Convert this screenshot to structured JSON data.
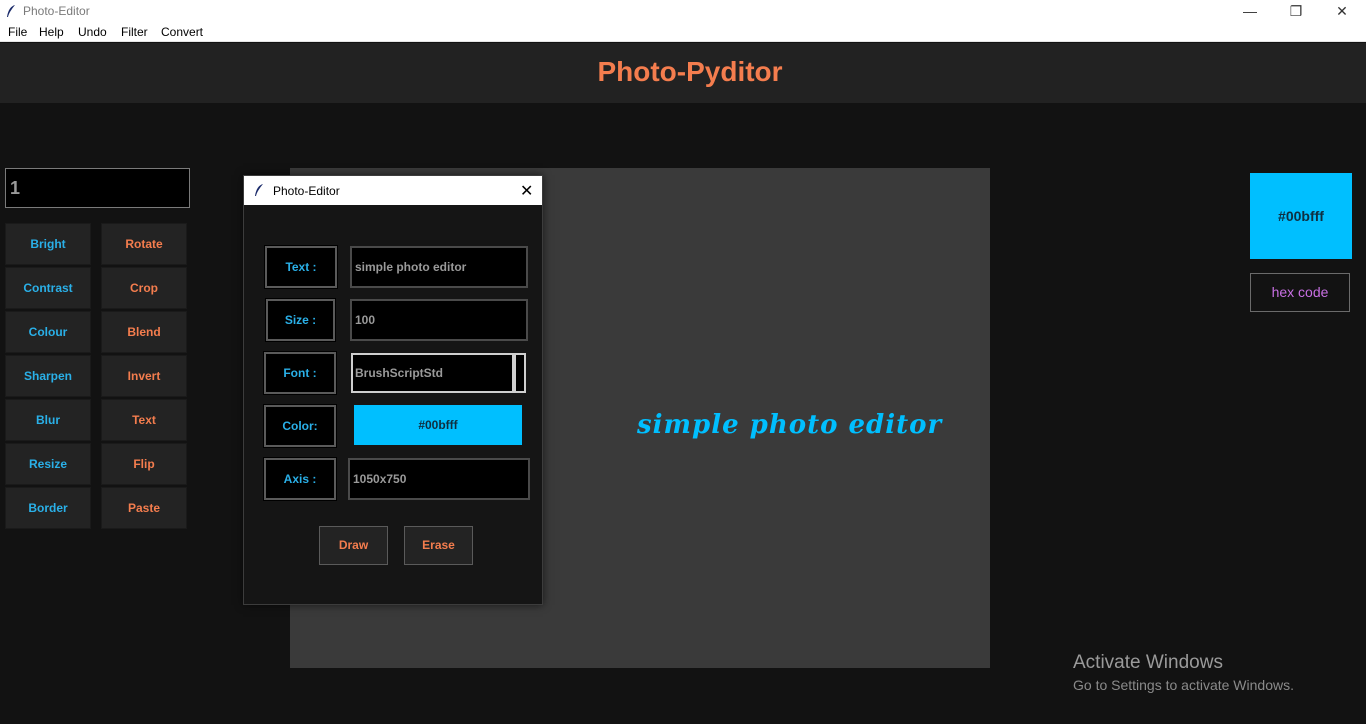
{
  "window": {
    "title": "Photo-Editor",
    "minimize": "—",
    "maximize": "❐",
    "close": "✕"
  },
  "menu": {
    "items": [
      "File",
      "Help",
      "Undo",
      "Filter",
      "Convert"
    ]
  },
  "header": {
    "title": "Photo-Pyditor"
  },
  "left_panel": {
    "value": "1",
    "tools_left": [
      "Bright",
      "Contrast",
      "Colour",
      "Sharpen",
      "Blur",
      "Resize",
      "Border"
    ],
    "tools_right": [
      "Rotate",
      "Crop",
      "Blend",
      "Invert",
      "Text",
      "Flip",
      "Paste"
    ]
  },
  "canvas": {
    "text": "simple photo editor"
  },
  "right_panel": {
    "swatch_label": "#00bfff",
    "hex_button": "hex code"
  },
  "dialog": {
    "title": "Photo-Editor",
    "close": "✕",
    "text_label": "Text :",
    "text_value": "simple photo editor",
    "size_label": "Size :",
    "size_value": "100",
    "font_label": "Font :",
    "font_value": "BrushScriptStd",
    "color_label": "Color:",
    "color_value": "#00bfff",
    "axis_label": "Axis :",
    "axis_value": "1050x750",
    "draw_button": "Draw",
    "erase_button": "Erase"
  },
  "watermark": {
    "title": "Activate Windows",
    "subtitle": "Go to Settings to activate Windows."
  },
  "colors": {
    "accent_orange": "#f47d4e",
    "accent_blue": "#2ab0e8",
    "selected_color": "#00bfff"
  }
}
